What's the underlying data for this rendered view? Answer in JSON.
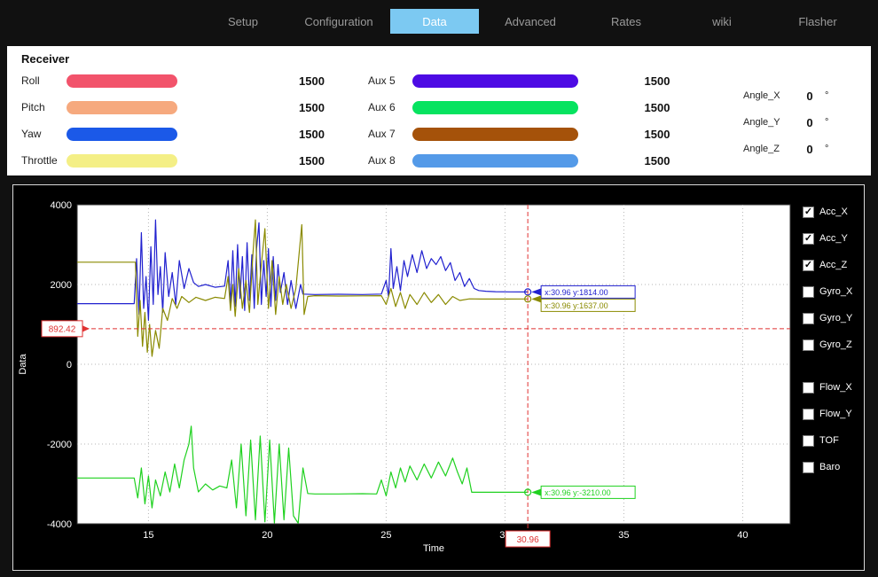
{
  "nav": {
    "active_color": "#7cc9f2",
    "tabs": [
      {
        "label": "Setup",
        "active": false
      },
      {
        "label": "Configuration",
        "active": false
      },
      {
        "label": "Data",
        "active": true
      },
      {
        "label": "Advanced",
        "active": false
      },
      {
        "label": "Rates",
        "active": false
      },
      {
        "label": "wiki",
        "active": false
      },
      {
        "label": "Flasher",
        "active": false
      }
    ]
  },
  "receiver": {
    "title": "Receiver",
    "channels_left": [
      {
        "label": "Roll",
        "value": "1500",
        "color": "#f2536b"
      },
      {
        "label": "Pitch",
        "value": "1500",
        "color": "#f6a97e"
      },
      {
        "label": "Yaw",
        "value": "1500",
        "color": "#1b59e8"
      },
      {
        "label": "Throttle",
        "value": "1500",
        "color": "#f4ef86"
      }
    ],
    "channels_aux": [
      {
        "label": "Aux 5",
        "value": "1500",
        "color": "#4d0be4"
      },
      {
        "label": "Aux 6",
        "value": "1500",
        "color": "#06e35f"
      },
      {
        "label": "Aux 7",
        "value": "1500",
        "color": "#a5520a"
      },
      {
        "label": "Aux 8",
        "value": "1500",
        "color": "#549ae8"
      }
    ],
    "angles": [
      {
        "label": "Angle_X",
        "value": "0",
        "unit": "°"
      },
      {
        "label": "Angle_Y",
        "value": "0",
        "unit": "°"
      },
      {
        "label": "Angle_Z",
        "value": "0",
        "unit": "°"
      }
    ]
  },
  "chart_data": {
    "type": "line",
    "title": "",
    "xlabel": "Time",
    "ylabel": "Data",
    "xlim": [
      12,
      42
    ],
    "ylim": [
      -4000,
      4000
    ],
    "xticks": [
      15,
      20,
      25,
      30,
      35,
      40
    ],
    "yticks": [
      4000,
      2000,
      0,
      -2000,
      -4000
    ],
    "grid": true,
    "cursor": {
      "x": 30.96,
      "y": 892.42,
      "x_label": "30.96",
      "y_label": "892.42",
      "color": "#e03131"
    },
    "tooltips": [
      {
        "series": "Acc_X",
        "x": 30.96,
        "y": 1814,
        "text": "x:30.96 y:1814.00"
      },
      {
        "series": "Acc_Y",
        "x": 30.96,
        "y": 1637,
        "text": "x:30.96 y:1637.00"
      },
      {
        "series": "Acc_Z",
        "x": 30.96,
        "y": -3210,
        "text": "x:30.96 y:-3210.00"
      }
    ],
    "series": [
      {
        "name": "Acc_X",
        "color": "#2121cf",
        "points": [
          [
            12,
            1520
          ],
          [
            14.4,
            1520
          ],
          [
            14.5,
            2650
          ],
          [
            14.6,
            1250
          ],
          [
            14.7,
            3300
          ],
          [
            14.8,
            1400
          ],
          [
            14.9,
            2200
          ],
          [
            15,
            1100
          ],
          [
            15.1,
            2950
          ],
          [
            15.2,
            1500
          ],
          [
            15.3,
            3620
          ],
          [
            15.4,
            1750
          ],
          [
            15.5,
            2450
          ],
          [
            15.6,
            1300
          ],
          [
            15.7,
            2800
          ],
          [
            15.85,
            1700
          ],
          [
            16,
            2300
          ],
          [
            16.15,
            1500
          ],
          [
            16.3,
            2600
          ],
          [
            16.5,
            1900
          ],
          [
            16.7,
            2400
          ],
          [
            16.9,
            2050
          ],
          [
            17.1,
            1950
          ],
          [
            17.4,
            2000
          ],
          [
            17.8,
            1930
          ],
          [
            18.2,
            1960
          ],
          [
            18.35,
            2600
          ],
          [
            18.45,
            1500
          ],
          [
            18.55,
            2850
          ],
          [
            18.65,
            1450
          ],
          [
            18.75,
            3000
          ],
          [
            18.85,
            1650
          ],
          [
            18.95,
            2700
          ],
          [
            19.05,
            1350
          ],
          [
            19.15,
            3050
          ],
          [
            19.25,
            1600
          ],
          [
            19.35,
            2750
          ],
          [
            19.45,
            1400
          ],
          [
            19.55,
            2900
          ],
          [
            19.65,
            3550
          ],
          [
            19.75,
            1500
          ],
          [
            19.85,
            2600
          ],
          [
            19.95,
            1700
          ],
          [
            20.05,
            2900
          ],
          [
            20.15,
            1450
          ],
          [
            20.25,
            2700
          ],
          [
            20.35,
            1600
          ],
          [
            20.45,
            2500
          ],
          [
            20.55,
            1800
          ],
          [
            20.7,
            2300
          ],
          [
            20.85,
            1500
          ],
          [
            21,
            2100
          ],
          [
            21.2,
            1400
          ],
          [
            21.4,
            2000
          ],
          [
            21.5,
            1760
          ],
          [
            22,
            1750
          ],
          [
            23,
            1755
          ],
          [
            24,
            1750
          ],
          [
            24.8,
            1760
          ],
          [
            25,
            2100
          ],
          [
            25.1,
            1700
          ],
          [
            25.2,
            2900
          ],
          [
            25.3,
            1900
          ],
          [
            25.45,
            2450
          ],
          [
            25.6,
            1850
          ],
          [
            25.75,
            2600
          ],
          [
            25.9,
            2200
          ],
          [
            26.1,
            2750
          ],
          [
            26.3,
            2300
          ],
          [
            26.5,
            2850
          ],
          [
            26.7,
            2400
          ],
          [
            26.9,
            2650
          ],
          [
            27.1,
            2500
          ],
          [
            27.3,
            2700
          ],
          [
            27.5,
            2350
          ],
          [
            27.7,
            2550
          ],
          [
            27.9,
            2100
          ],
          [
            28.1,
            2300
          ],
          [
            28.3,
            1950
          ],
          [
            28.5,
            2150
          ],
          [
            28.7,
            1900
          ],
          [
            28.9,
            1850
          ],
          [
            29.2,
            1830
          ],
          [
            29.6,
            1820
          ],
          [
            30.2,
            1815
          ],
          [
            30.96,
            1814
          ]
        ]
      },
      {
        "name": "Acc_Y",
        "color": "#8a8a00",
        "points": [
          [
            12,
            2560
          ],
          [
            14.45,
            2560
          ],
          [
            14.55,
            700
          ],
          [
            14.65,
            1600
          ],
          [
            14.75,
            450
          ],
          [
            14.85,
            1300
          ],
          [
            14.95,
            300
          ],
          [
            15.05,
            1000
          ],
          [
            15.15,
            200
          ],
          [
            15.3,
            850
          ],
          [
            15.45,
            400
          ],
          [
            15.6,
            1400
          ],
          [
            15.8,
            1100
          ],
          [
            16,
            1650
          ],
          [
            16.2,
            1400
          ],
          [
            16.4,
            1700
          ],
          [
            16.7,
            1550
          ],
          [
            17,
            1680
          ],
          [
            17.4,
            1600
          ],
          [
            17.8,
            1680
          ],
          [
            18.2,
            1650
          ],
          [
            18.35,
            2200
          ],
          [
            18.45,
            1350
          ],
          [
            18.55,
            2000
          ],
          [
            18.65,
            1200
          ],
          [
            18.8,
            2400
          ],
          [
            18.95,
            1400
          ],
          [
            19.1,
            2100
          ],
          [
            19.25,
            1300
          ],
          [
            19.4,
            2800
          ],
          [
            19.5,
            3620
          ],
          [
            19.6,
            1500
          ],
          [
            19.75,
            2500
          ],
          [
            19.9,
            3400
          ],
          [
            20.05,
            1400
          ],
          [
            20.2,
            2600
          ],
          [
            20.35,
            1250
          ],
          [
            20.5,
            2200
          ],
          [
            20.65,
            1500
          ],
          [
            20.8,
            2000
          ],
          [
            21,
            1400
          ],
          [
            21.2,
            1900
          ],
          [
            21.45,
            3500
          ],
          [
            21.55,
            1250
          ],
          [
            21.7,
            1700
          ],
          [
            22,
            1720
          ],
          [
            23,
            1710
          ],
          [
            24,
            1715
          ],
          [
            24.8,
            1720
          ],
          [
            25,
            1500
          ],
          [
            25.2,
            1900
          ],
          [
            25.4,
            1450
          ],
          [
            25.6,
            1800
          ],
          [
            25.8,
            1400
          ],
          [
            26,
            1750
          ],
          [
            26.3,
            1500
          ],
          [
            26.6,
            1800
          ],
          [
            26.9,
            1550
          ],
          [
            27.2,
            1750
          ],
          [
            27.5,
            1500
          ],
          [
            27.8,
            1700
          ],
          [
            28.1,
            1600
          ],
          [
            28.5,
            1640
          ],
          [
            29,
            1635
          ],
          [
            30,
            1636
          ],
          [
            30.96,
            1637
          ]
        ]
      },
      {
        "name": "Acc_Z",
        "color": "#1fd11f",
        "points": [
          [
            12,
            -2850
          ],
          [
            14.4,
            -2850
          ],
          [
            14.55,
            -3350
          ],
          [
            14.7,
            -2600
          ],
          [
            14.85,
            -3500
          ],
          [
            15,
            -2800
          ],
          [
            15.15,
            -3600
          ],
          [
            15.3,
            -2900
          ],
          [
            15.5,
            -3300
          ],
          [
            15.7,
            -2700
          ],
          [
            15.9,
            -3200
          ],
          [
            16.1,
            -2500
          ],
          [
            16.3,
            -3100
          ],
          [
            16.5,
            -2400
          ],
          [
            16.7,
            -2000
          ],
          [
            16.8,
            -1550
          ],
          [
            16.9,
            -2600
          ],
          [
            17.1,
            -3200
          ],
          [
            17.4,
            -3000
          ],
          [
            17.7,
            -3150
          ],
          [
            18,
            -3050
          ],
          [
            18.3,
            -3100
          ],
          [
            18.5,
            -2400
          ],
          [
            18.7,
            -3600
          ],
          [
            18.9,
            -2000
          ],
          [
            19.1,
            -3800
          ],
          [
            19.3,
            -1900
          ],
          [
            19.5,
            -3900
          ],
          [
            19.7,
            -1800
          ],
          [
            19.9,
            -3950
          ],
          [
            20.1,
            -1900
          ],
          [
            20.3,
            -3980
          ],
          [
            20.5,
            -2000
          ],
          [
            20.7,
            -3900
          ],
          [
            20.9,
            -2100
          ],
          [
            21.1,
            -3800
          ],
          [
            21.3,
            -3985
          ],
          [
            21.5,
            -2600
          ],
          [
            21.7,
            -3240
          ],
          [
            22,
            -3250
          ],
          [
            23,
            -3250
          ],
          [
            24,
            -3245
          ],
          [
            24.6,
            -3250
          ],
          [
            24.8,
            -2900
          ],
          [
            25,
            -3300
          ],
          [
            25.2,
            -2700
          ],
          [
            25.4,
            -3100
          ],
          [
            25.6,
            -2600
          ],
          [
            25.8,
            -2950
          ],
          [
            26,
            -2550
          ],
          [
            26.3,
            -2900
          ],
          [
            26.6,
            -2500
          ],
          [
            26.9,
            -2850
          ],
          [
            27.2,
            -2450
          ],
          [
            27.5,
            -2800
          ],
          [
            27.8,
            -2350
          ],
          [
            28,
            -2700
          ],
          [
            28.2,
            -3000
          ],
          [
            28.4,
            -2600
          ],
          [
            28.6,
            -3210
          ],
          [
            29.5,
            -3210
          ],
          [
            30.96,
            -3210
          ]
        ]
      }
    ]
  },
  "legend": {
    "groups": [
      {
        "items": [
          {
            "label": "Acc_X",
            "checked": true
          },
          {
            "label": "Acc_Y",
            "checked": true
          },
          {
            "label": "Acc_Z",
            "checked": true
          }
        ]
      },
      {
        "items": [
          {
            "label": "Gyro_X",
            "checked": false
          },
          {
            "label": "Gyro_Y",
            "checked": false
          },
          {
            "label": "Gyro_Z",
            "checked": false
          }
        ]
      },
      {
        "items": [
          {
            "label": "Flow_X",
            "checked": false
          },
          {
            "label": "Flow_Y",
            "checked": false
          }
        ]
      },
      {
        "items": [
          {
            "label": "TOF",
            "checked": false
          }
        ]
      },
      {
        "items": [
          {
            "label": "Baro",
            "checked": false
          }
        ]
      }
    ]
  }
}
